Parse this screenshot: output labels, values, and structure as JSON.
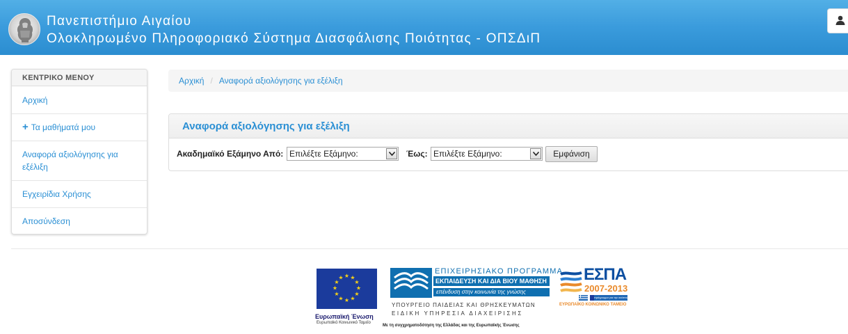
{
  "header": {
    "line1": "Πανεπιστήμιο Αιγαίου",
    "line2": "Ολοκληρωμένο Πληροφοριακό Σύστημα Διασφάλισης Ποιότητας - ΟΠΣΔιΠ",
    "logo_icon": "university-seal-logo",
    "user_icon": "user-icon",
    "colors": {
      "bar_top": "#52afe6",
      "bar_bottom": "#2b8dd0",
      "text": "#ffffff"
    }
  },
  "sidebar": {
    "heading": "ΚΕΝΤΡΙΚΟ ΜΕΝΟΥ",
    "items": [
      {
        "label": "Αρχική"
      },
      {
        "label": "Τα μαθήματά μου",
        "icon": "plus-icon"
      },
      {
        "label": "Αναφορά αξιολόγησης για εξέλιξη"
      },
      {
        "label": "Εγχειρίδια Χρήσης"
      },
      {
        "label": "Αποσύνδεση"
      }
    ],
    "link_color": "#2a8fd4"
  },
  "breadcrumb": {
    "items": [
      {
        "label": "Αρχική"
      },
      {
        "label": "Αναφορά αξιολόγησης για εξέλιξη"
      }
    ],
    "separator": "/"
  },
  "panel": {
    "title": "Αναφορά αξιολόγησης για εξέλιξη",
    "from_label": "Ακαδημαϊκό Εξάμηνο Από:",
    "from_value": "Επιλέξτε Εξάμηνο:",
    "to_label": "Έως:",
    "to_value": "Επιλέξτε Εξάμηνο:",
    "submit_label": "Εμφάνιση"
  },
  "footer": {
    "eu_name": "Ευρωπαϊκή Ένωση",
    "eu_fund": "Ευρωπαϊκό Κοινωνικό Ταμείο",
    "op_title": "ΕΠΙΧΕΙΡΗΣΙΑΚΟ ΠΡΟΓΡΑΜΜΑ",
    "op_name": "ΕΚΠΑΙΔΕΥΣΗ ΚΑΙ ΔΙΑ ΒΙΟΥ ΜΑΘΗΣΗ",
    "op_slogan": "επένδυση στην κοινωνία της γνώσης",
    "ministry": "ΥΠΟΥΡΓΕΙΟ ΠΑΙΔΕΙΑΣ ΚΑΙ ΘΡΗΣΚΕΥΜΑΤΩΝ",
    "authority": "ΕΙΔΙΚΗ ΥΠΗΡΕΣΙΑ ΔΙΑΧΕΙΡΙΣΗΣ",
    "cofunding": "Με τη συγχρηματοδότηση της Ελλάδας και της Ευρωπαϊκής Ένωσης",
    "espa_word": "ΕΣΠΑ",
    "espa_years": "2007-2013",
    "espa_strip": "πρόγραμμα για την ανάπτυξη",
    "espa_fund": "ΕΥΡΩΠΑΪΚΟ ΚΟΙΝΩΝΙΚΟ ΤΑΜΕΙΟ"
  }
}
